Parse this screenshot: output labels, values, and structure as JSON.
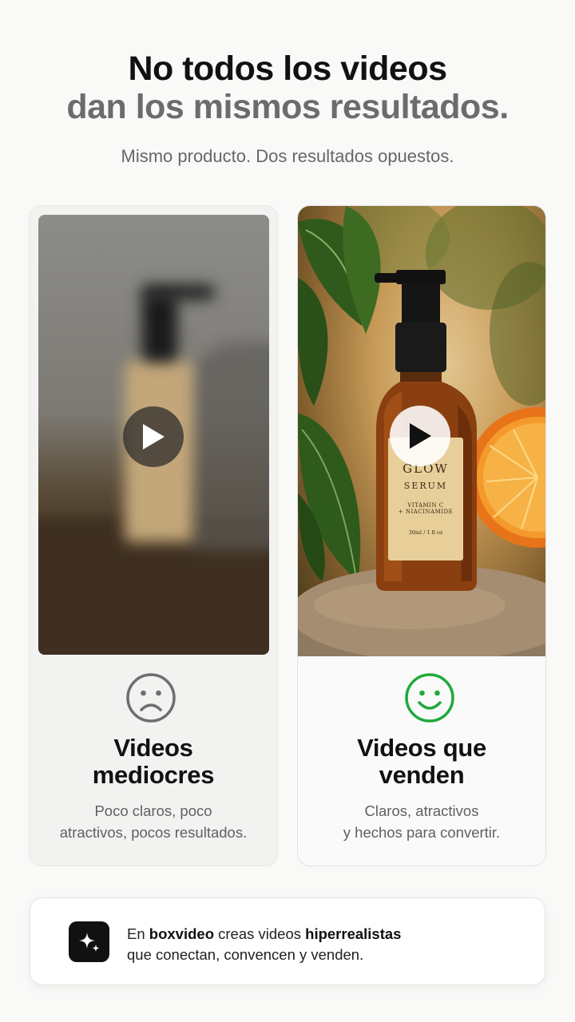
{
  "header": {
    "title_line1": "No todos los videos",
    "title_line2": "dan los mismos resultados.",
    "subtitle": "Mismo producto. Dos resultados opuestos."
  },
  "cards": [
    {
      "variant": "bad",
      "face_icon": "sad-face-icon",
      "face_color": "#6e6e6e",
      "title_line1": "Videos",
      "title_line2": "mediocres",
      "desc_line1": "Poco claros, poco",
      "desc_line2": "atractivos, pocos resultados."
    },
    {
      "variant": "good",
      "face_icon": "happy-face-icon",
      "face_color": "#1faa3d",
      "title_line1": "Videos que",
      "title_line2": "venden",
      "desc_line1": "Claros, atractivos",
      "desc_line2": "y hechos para convertir.",
      "product": {
        "brand": "GLOW",
        "name": "SERUM",
        "ingredients_line1": "VITAMIN C",
        "ingredients_line2": "+ NIACINAMIDE",
        "volume": "30ml / 1 fl oz"
      }
    }
  ],
  "banner": {
    "icon": "sparkle-icon",
    "pre": "En",
    "brand": "boxvideo",
    "mid": "creas videos",
    "highlight": "hiperrealistas",
    "line2": "que conectan, convencen y venden."
  }
}
